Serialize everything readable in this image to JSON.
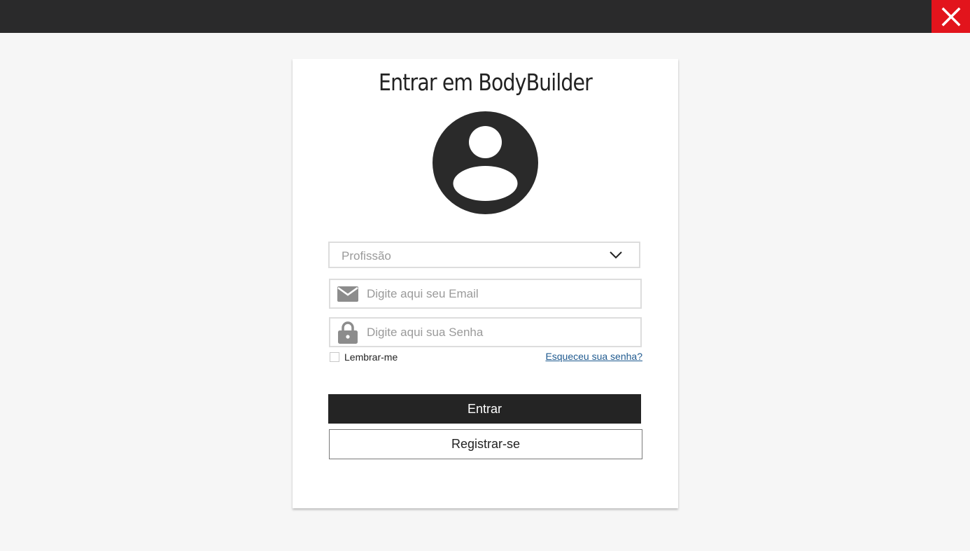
{
  "window": {
    "close_icon": "close-icon",
    "close_color": "#e2141c",
    "topbar_color": "#2a2a2b"
  },
  "login": {
    "title": "Entrar em BodyBuilder",
    "avatar_icon": "user-avatar-icon",
    "profession": {
      "placeholder": "Profissão",
      "icon": "chevron-down-icon"
    },
    "email": {
      "placeholder": "Digite aqui seu Email",
      "value": "",
      "icon": "envelope-icon"
    },
    "password": {
      "placeholder": "Digite aqui sua Senha",
      "value": "",
      "icon": "lock-icon"
    },
    "remember_label": "Lembrar-me",
    "remember_checked": false,
    "forgot_label": "Esqueceu sua senha?",
    "submit_label": "Entrar",
    "register_label": "Registrar-se"
  }
}
